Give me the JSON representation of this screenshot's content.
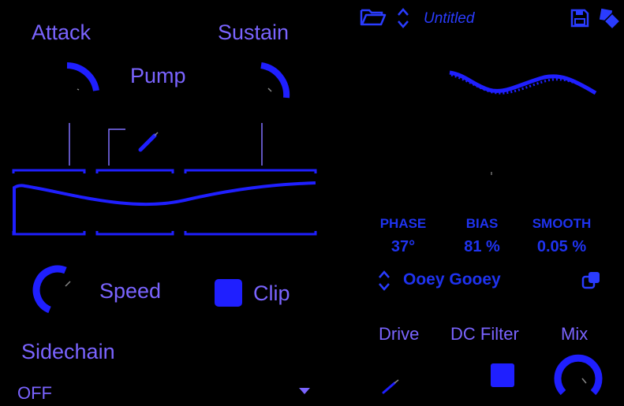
{
  "colors": {
    "background": "#000000",
    "accent": "#1f1fff",
    "label": "#7a64ff"
  },
  "left": {
    "attack_label": "Attack",
    "sustain_label": "Sustain",
    "pump_label": "Pump",
    "speed_label": "Speed",
    "clip_label": "Clip",
    "clip_checked": true,
    "sidechain_label": "Sidechain",
    "sidechain_value": "OFF"
  },
  "header": {
    "preset_title": "Untitled",
    "icons": [
      "folder-open-icon",
      "up-down-chevron-icon",
      "save-icon",
      "layers-icon"
    ]
  },
  "params": {
    "phase": {
      "label": "PHASE",
      "value": "37°"
    },
    "bias": {
      "label": "BIAS",
      "value": "81 %"
    },
    "smooth": {
      "label": "SMOOTH",
      "value": "0.05 %"
    }
  },
  "preset_row": {
    "name": "Ooey Gooey"
  },
  "bottom": {
    "drive_label": "Drive",
    "dc_filter_label": "DC Filter",
    "dc_filter_checked": true,
    "mix_label": "Mix"
  }
}
